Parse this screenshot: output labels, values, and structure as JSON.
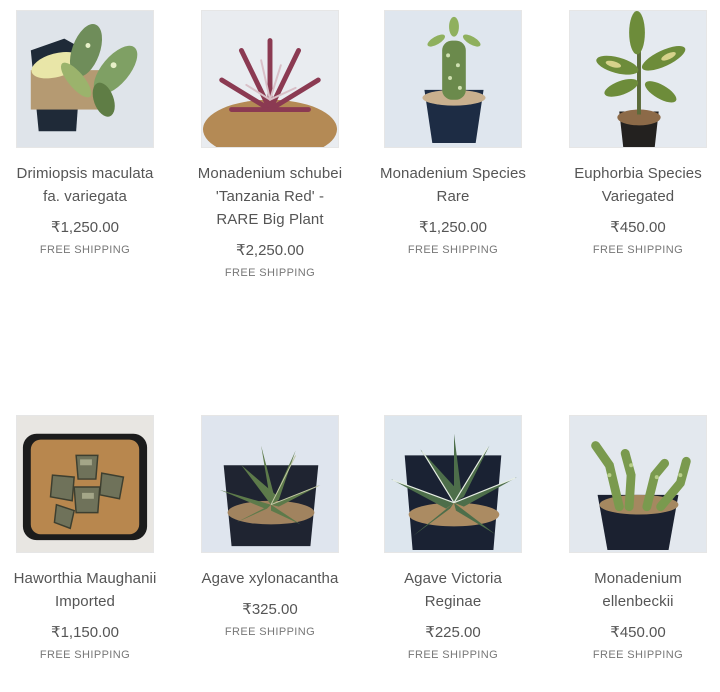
{
  "products": [
    {
      "name": "Drimiopsis maculata fa. variegata",
      "price": "₹1,250.00",
      "shipping": "FREE SHIPPING",
      "image_icon": "drimiopsis-plant-image"
    },
    {
      "name": "Monadenium schubei 'Tanzania Red' - RARE Big Plant",
      "price": "₹2,250.00",
      "shipping": "FREE SHIPPING",
      "image_icon": "monadenium-schubei-plant-image"
    },
    {
      "name": "Monadenium Species Rare",
      "price": "₹1,250.00",
      "shipping": "FREE SHIPPING",
      "image_icon": "monadenium-species-plant-image"
    },
    {
      "name": "Euphorbia Species Variegated",
      "price": "₹450.00",
      "shipping": "FREE SHIPPING",
      "image_icon": "euphorbia-plant-image"
    },
    {
      "name": "Haworthia Maughanii Imported",
      "price": "₹1,150.00",
      "shipping": "FREE SHIPPING",
      "image_icon": "haworthia-plant-image"
    },
    {
      "name": "Agave xylonacantha",
      "price": "₹325.00",
      "shipping": "FREE SHIPPING",
      "image_icon": "agave-xylonacantha-plant-image"
    },
    {
      "name": "Agave Victoria Reginae",
      "price": "₹225.00",
      "shipping": "FREE SHIPPING",
      "image_icon": "agave-victoria-plant-image"
    },
    {
      "name": "Monadenium ellenbeckii",
      "price": "₹450.00",
      "shipping": "FREE SHIPPING",
      "image_icon": "monadenium-ellenbeckii-plant-image"
    }
  ]
}
